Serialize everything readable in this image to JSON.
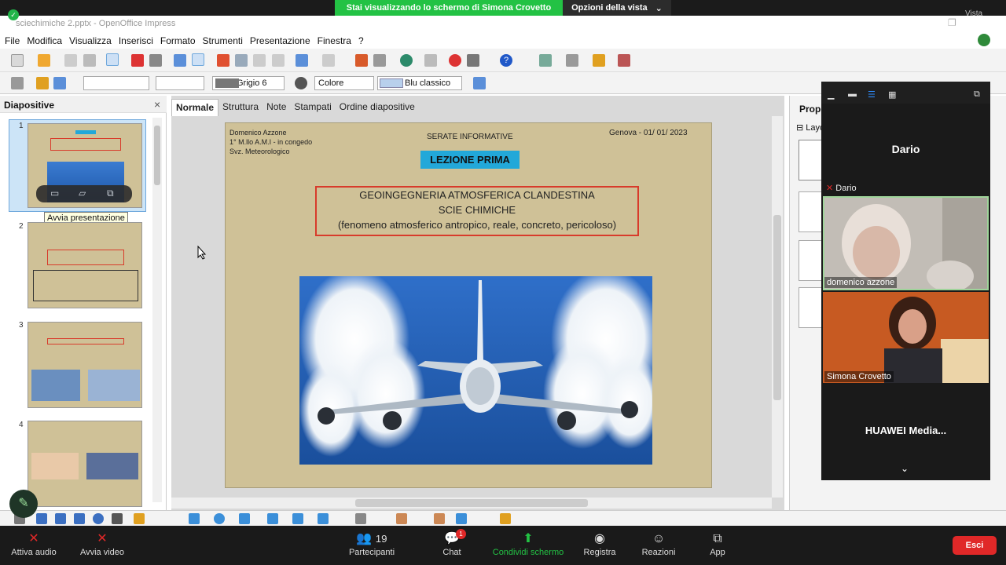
{
  "share_banner": {
    "message": "Stai visualizzando lo schermo di Simona Crovetto",
    "options_label": "Opzioni della vista",
    "view_label": "Vista"
  },
  "window": {
    "title": "sciechimiche 2.pptx - OpenOffice Impress"
  },
  "menu": [
    "File",
    "Modifica",
    "Visualizza",
    "Inserisci",
    "Formato",
    "Strumenti",
    "Presentazione",
    "Finestra",
    "?"
  ],
  "toolbar2": {
    "line_color": "Grigio 6",
    "area_type": "Colore",
    "area_color": "Blu classico"
  },
  "slides_panel": {
    "title": "Diapositive",
    "close": "×",
    "tooltip": "Avvia presentazione",
    "slide_numbers": [
      "1",
      "2",
      "3",
      "4"
    ]
  },
  "view_tabs": [
    "Normale",
    "Struttura",
    "Note",
    "Stampati",
    "Ordine diapositive"
  ],
  "slide": {
    "author_lines": [
      "Domenico Azzone",
      "1° M.llo A.M.I - in congedo",
      "Svz. Meteorologico"
    ],
    "series": "SERATE INFORMATIVE",
    "date": "Genova - 01/ 01/ 2023",
    "lesson": "LEZIONE PRIMA",
    "box_lines": [
      "GEOINGEGNERIA ATMOSFERICA CLANDESTINA",
      "SCIE CHIMICHE",
      "(fenomeno atmosferico antropico, reale, concreto, pericoloso)"
    ]
  },
  "properties": {
    "title": "Prope",
    "layouts": "Layo"
  },
  "participants_panel": {
    "dario_name": "Dario",
    "dario_tag": "Dario",
    "cam1_name": "domenico azzone",
    "cam2_name": "Simona Crovetto",
    "huawei": "HUAWEI  Media..."
  },
  "meeting_controls": {
    "audio": "Attiva audio",
    "video": "Avvia video",
    "participants": "Partecipanti",
    "participants_count": "19",
    "chat": "Chat",
    "chat_badge": "1",
    "share": "Condividi schermo",
    "record": "Registra",
    "reactions": "Reazioni",
    "apps": "App",
    "exit": "Esci"
  },
  "colors": {
    "share_green": "#23c244",
    "slide_bg": "#cfc197",
    "lesson_blue": "#22a8d9",
    "box_red": "#d83b2b",
    "exit_red": "#e02828"
  }
}
